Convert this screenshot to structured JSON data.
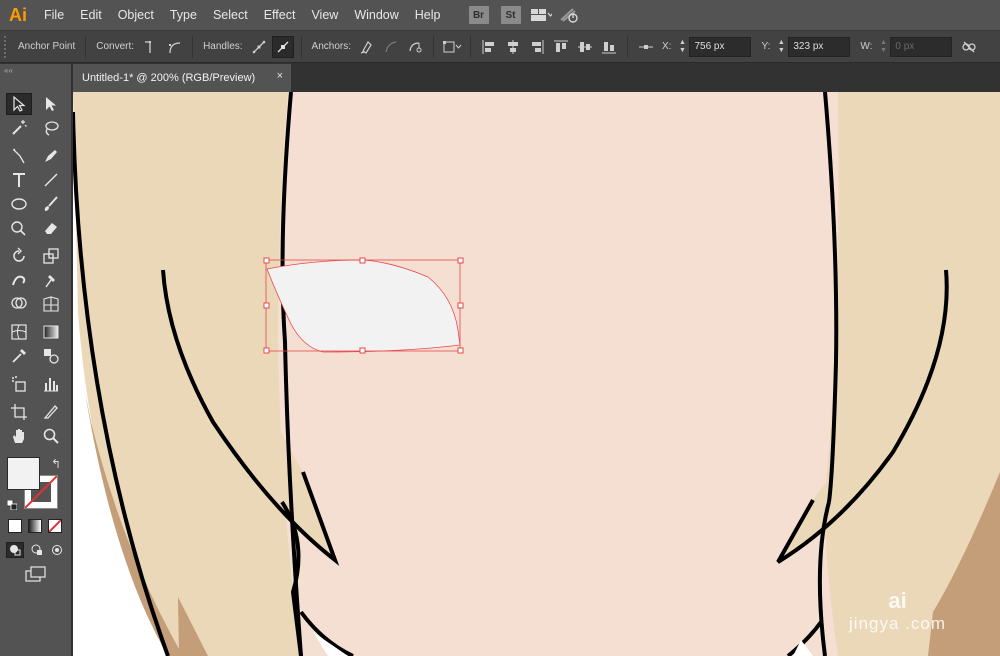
{
  "app": {
    "logo": "Ai",
    "menus": [
      "File",
      "Edit",
      "Object",
      "Type",
      "Select",
      "Effect",
      "View",
      "Window",
      "Help"
    ],
    "badges": [
      "Br",
      "St"
    ]
  },
  "control_bar": {
    "tool_name": "Anchor Point",
    "convert_label": "Convert:",
    "handles_label": "Handles:",
    "anchors_label": "Anchors:",
    "x_label": "X:",
    "x_value": "756 px",
    "y_label": "Y:",
    "y_value": "323 px",
    "w_label": "W:",
    "w_value": "0 px"
  },
  "document": {
    "tab_title": "Untitled-1* @ 200% (RGB/Preview)",
    "tab_close": "×"
  },
  "colors": {
    "accent": "#ff9a00",
    "skin": "#f5dfd2",
    "hair": "#ead8b8",
    "hair_shadow": "#c49e78",
    "selection": "#e8484c",
    "shape_fill": "#f2f2f2"
  },
  "icons": {
    "panel_collapse": "««",
    "swap_colors": "↰"
  },
  "watermark": {
    "line1": "ai",
    "line2": "jingya  .com"
  }
}
